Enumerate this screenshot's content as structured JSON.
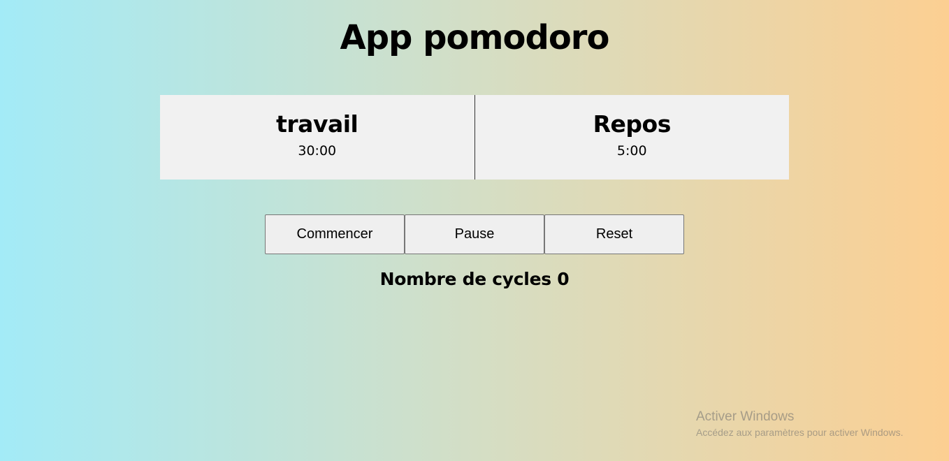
{
  "title": "App pomodoro",
  "timers": {
    "work": {
      "label": "travail",
      "time": "30:00"
    },
    "rest": {
      "label": "Repos",
      "time": "5:00"
    }
  },
  "controls": {
    "start_label": "Commencer",
    "pause_label": "Pause",
    "reset_label": "Reset"
  },
  "cycles": {
    "label": "Nombre de cycles",
    "count": "0"
  },
  "watermark": {
    "title": "Activer Windows",
    "subtitle": "Accédez aux paramètres pour activer Windows."
  },
  "colors": {
    "gradient_start": "#a3ebf7",
    "gradient_mid": "#d4dec5",
    "gradient_end": "#fccf92",
    "panel_background": "#f1f1f1",
    "button_background": "#efefef"
  }
}
